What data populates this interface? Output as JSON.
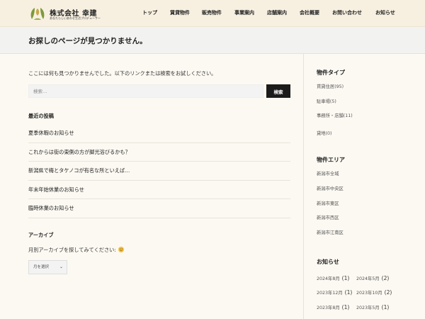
{
  "header": {
    "logo_title": "株式会社 幸建",
    "logo_subtitle": "あなたらしいあわせ生活プロデューサー",
    "nav": [
      {
        "label": "トップ",
        "name": "nav-top"
      },
      {
        "label": "賃貸物件",
        "name": "nav-rental"
      },
      {
        "label": "販売物件",
        "name": "nav-sales"
      },
      {
        "label": "事業案内",
        "name": "nav-business"
      },
      {
        "label": "店舗案内",
        "name": "nav-store"
      },
      {
        "label": "会社概要",
        "name": "nav-company"
      },
      {
        "label": "お問い合わせ",
        "name": "nav-contact"
      },
      {
        "label": "お知らせ",
        "name": "nav-news"
      }
    ]
  },
  "page": {
    "title": "お探しのページが見つかりません。",
    "message": "ここには何も見つかりませんでした。以下のリンクまたは検索をお試しください。"
  },
  "search": {
    "placeholder": "検索…",
    "button_label": "検索"
  },
  "recent_posts": {
    "heading": "最近の投稿",
    "items": [
      "夏季休暇のお知らせ",
      "これからは街の東側の方が脚光浴びるかも？",
      "新潟県で梅とタケノコが有名な所といえば…",
      "年末年始休業のお知らせ",
      "臨時休業のお知らせ"
    ]
  },
  "archives": {
    "heading": "アーカイブ",
    "prompt": "月別アーカイブを探してみてください: ",
    "select_value": "月を選択"
  },
  "sidebar": {
    "property_type": {
      "heading": "物件タイプ",
      "items": [
        {
          "label": "賃貸住居",
          "count": "(95)"
        },
        {
          "label": "駐車場",
          "count": "(5)"
        },
        {
          "label": "事務所・店舗",
          "count": "(11)"
        },
        {
          "label": "貸地",
          "count": "(0)"
        }
      ]
    },
    "property_area": {
      "heading": "物件エリア",
      "items": [
        "新潟市全域",
        "新潟市中央区",
        "新潟市東区",
        "新潟市西区",
        "新潟市江南区"
      ]
    },
    "news": {
      "heading": "お知らせ",
      "items": [
        {
          "label": "2024年8月",
          "count": "(1)"
        },
        {
          "label": "2024年5月",
          "count": "(2)"
        },
        {
          "label": "2023年12月",
          "count": "(1)"
        },
        {
          "label": "2023年10月",
          "count": "(2)"
        },
        {
          "label": "2023年8月",
          "count": "(1)"
        },
        {
          "label": "2023年5月",
          "count": "(1)"
        }
      ]
    }
  },
  "colors": {
    "header_bg": "#f7f0e1",
    "title_band_bg": "#f2f3f1",
    "page_bg": "#fcf9f2",
    "button_bg": "#1b1b1b",
    "logo_green": "#7d9a3a"
  }
}
